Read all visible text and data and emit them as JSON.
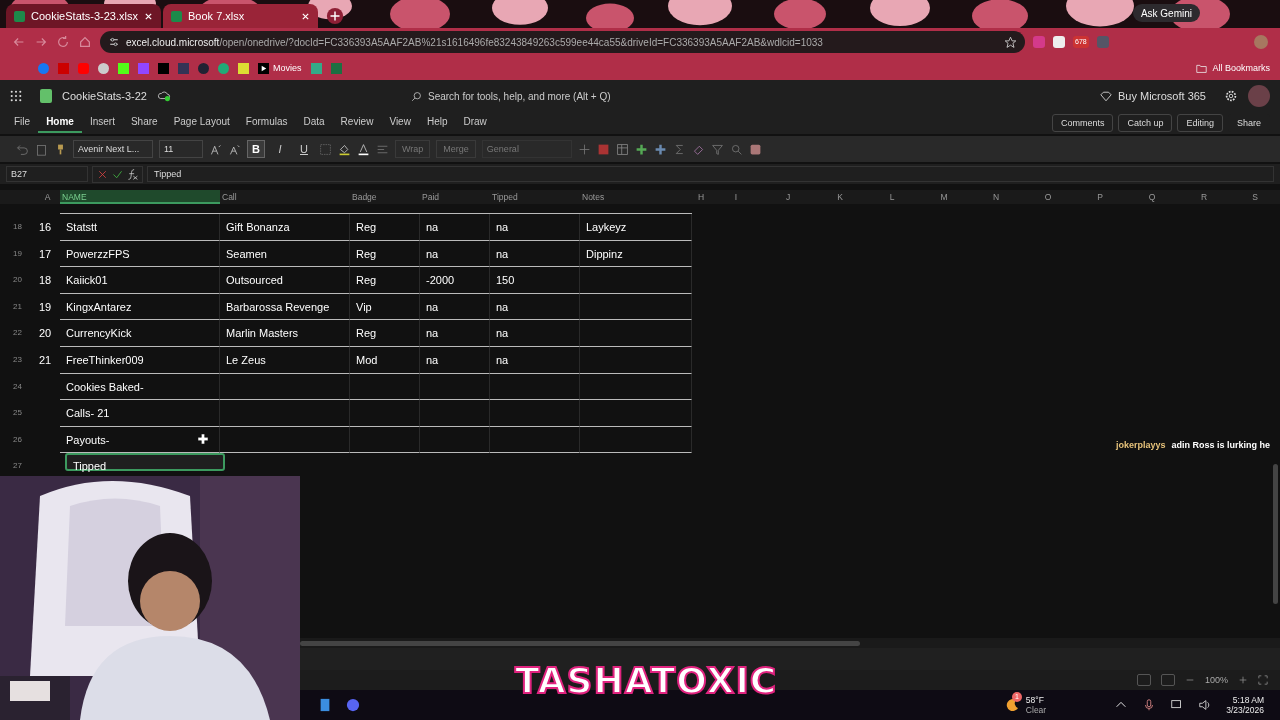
{
  "browser": {
    "tabs": [
      {
        "title": "CookieStats-3-23.xlsx",
        "selected": true
      },
      {
        "title": "Book 7.xlsx",
        "selected": false
      }
    ],
    "ask_gemini": "Ask Gemini",
    "url_host": "excel.cloud.microsoft",
    "url_path": "/open/onedrive/?docId=FC336393A5AAF2AB%21s1616496fe83243849263c599ee44ca55&driveId=FC336393A5AAF2AB&wdlcid=1033",
    "extension_badge": "678",
    "bookmark": "Movies",
    "all_bookmarks": "All Bookmarks"
  },
  "excel": {
    "doc_title": "CookieStats-3-22",
    "search_placeholder": "Search for tools, help, and more (Alt + Q)",
    "buy": "Buy Microsoft 365",
    "menu": [
      {
        "label": "File",
        "selected": false
      },
      {
        "label": "Home",
        "selected": true
      },
      {
        "label": "Insert",
        "selected": false
      },
      {
        "label": "Share",
        "selected": false
      },
      {
        "label": "Page Layout",
        "selected": false
      },
      {
        "label": "Formulas",
        "selected": false
      },
      {
        "label": "Data",
        "selected": false
      },
      {
        "label": "Review",
        "selected": false
      },
      {
        "label": "View",
        "selected": false
      },
      {
        "label": "Help",
        "selected": false
      },
      {
        "label": "Draw",
        "selected": false
      }
    ],
    "actions": [
      "Comments",
      "Catch up",
      "Editing",
      "Share"
    ],
    "font_name": "Avenir Next L...",
    "font_size": "11",
    "format_buttons": [
      {
        "glyph": "B",
        "selected": true
      },
      {
        "glyph": "I",
        "selected": false
      },
      {
        "glyph": "U",
        "selected": false
      }
    ],
    "wrap": "Wrap",
    "merge": "Merge",
    "number_format": "General",
    "name_box": "B27",
    "formula": "Tipped"
  },
  "grid": {
    "columns": [
      {
        "label": "A",
        "selected": false
      },
      {
        "label": "NAME",
        "selected": true
      },
      {
        "label": "Call",
        "selected": false
      },
      {
        "label": "Badge",
        "selected": false
      },
      {
        "label": "Paid",
        "selected": false
      },
      {
        "label": "Tipped",
        "selected": false
      },
      {
        "label": "Notes",
        "selected": false
      },
      {
        "label": "H",
        "selected": false
      },
      {
        "label": "I",
        "selected": false
      },
      {
        "label": "J",
        "selected": false
      },
      {
        "label": "K",
        "selected": false
      },
      {
        "label": "L",
        "selected": false
      },
      {
        "label": "M",
        "selected": false
      },
      {
        "label": "N",
        "selected": false
      },
      {
        "label": "O",
        "selected": false
      },
      {
        "label": "P",
        "selected": false
      },
      {
        "label": "Q",
        "selected": false
      },
      {
        "label": "R",
        "selected": false
      },
      {
        "label": "S",
        "selected": false
      }
    ],
    "rows": [
      {
        "num": "18",
        "active": false,
        "cells": [
          "16",
          "Statstt",
          "Gift Bonanza",
          "Reg",
          "na",
          "na",
          "Laykeyz"
        ]
      },
      {
        "num": "19",
        "active": false,
        "cells": [
          "17",
          "PowerzzFPS",
          "Seamen",
          "Reg",
          "na",
          "na",
          "Dippinz"
        ]
      },
      {
        "num": "20",
        "active": false,
        "cells": [
          "18",
          "Kaiick01",
          "Outsourced",
          "Reg",
          "-2000",
          "150",
          null
        ]
      },
      {
        "num": "21",
        "active": false,
        "cells": [
          "19",
          "KingxAntarez",
          "Barbarossa Revenge",
          "Vip",
          "na",
          "na",
          null
        ]
      },
      {
        "num": "22",
        "active": false,
        "cells": [
          "20",
          "CurrencyKick",
          "Marlin Masters",
          "Reg",
          "na",
          "na",
          null
        ]
      },
      {
        "num": "23",
        "active": false,
        "cells": [
          "21",
          "FreeThinker009",
          "Le Zeus",
          "Mod",
          "na",
          "na",
          null
        ]
      },
      {
        "num": "24",
        "active": false,
        "cells": [
          null,
          "Cookies Baked-",
          null,
          null,
          null,
          null,
          null
        ]
      },
      {
        "num": "25",
        "active": false,
        "cells": [
          null,
          "Calls- 21",
          null,
          null,
          null,
          null,
          null
        ]
      },
      {
        "num": "26",
        "active": false,
        "cells": [
          null,
          "Payouts-",
          null,
          null,
          null,
          null,
          null
        ]
      },
      {
        "num": "27",
        "active": true,
        "cells": [
          null,
          "Tipped",
          null,
          null,
          null,
          null,
          null
        ]
      }
    ]
  },
  "chat": {
    "user": "jokerplayys",
    "message": "adin Ross is lurking he"
  },
  "overlay_title": "TASHATOXIC",
  "status": {
    "zoom": "100%"
  },
  "taskbar": {
    "weather_badge": "1",
    "temperature": "58°F",
    "condition": "Clear",
    "time": "5:18 AM",
    "date": "3/23/2026"
  }
}
